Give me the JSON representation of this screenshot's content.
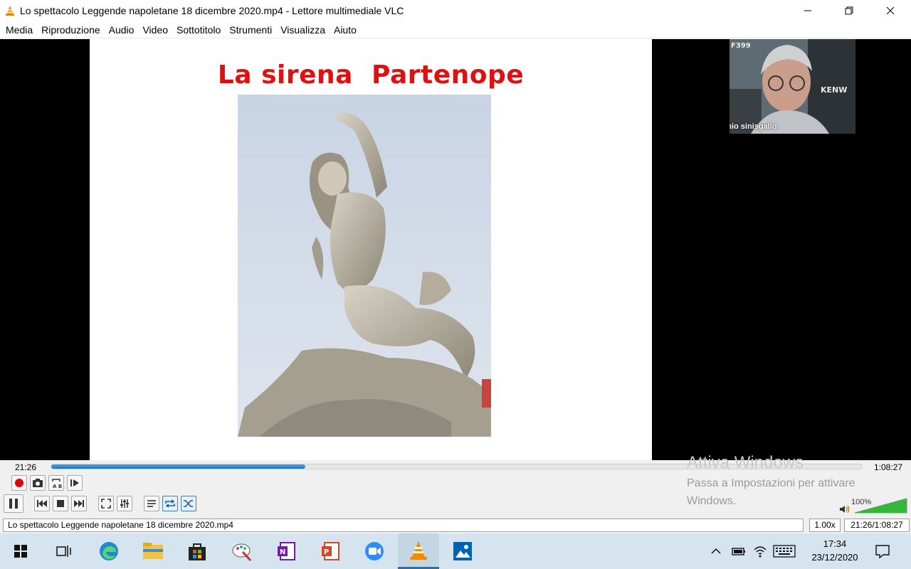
{
  "window": {
    "title": "Lo spettacolo Leggende napoletane 18 dicembre 2020.mp4 - Lettore multimediale VLC",
    "app_icon": "vlc-cone-icon"
  },
  "menu": [
    "Media",
    "Riproduzione",
    "Audio",
    "Video",
    "Sottotitolo",
    "Strumenti",
    "Visualizza",
    "Aiuto"
  ],
  "video": {
    "slide_title": "La sirena  Partenope",
    "webcam_name": "antonio sinisgallo",
    "webcam_bg_text_1": "F399",
    "webcam_bg_text_2": "KENW"
  },
  "playback": {
    "elapsed": "21:26",
    "total": "1:08:27",
    "progress": 0.313
  },
  "volume": {
    "label": "100%",
    "level": 1.0
  },
  "activation": {
    "title": "Attiva Windows",
    "line1": "Passa a Impostazioni per attivare",
    "line2": "Windows."
  },
  "status": {
    "filename": "Lo spettacolo Leggende napoletane 18 dicembre 2020.mp4",
    "speed": "1.00x",
    "time": "21:26/1:08:27"
  },
  "taskbar": {
    "time": "17:34",
    "date": "23/12/2020",
    "apps": [
      "task-view-icon",
      "edge-icon",
      "file-explorer-icon",
      "store-icon",
      "paint-icon",
      "onenote-icon",
      "powerpoint-icon",
      "zoom-icon",
      "vlc-icon",
      "photos-icon"
    ]
  },
  "colors": {
    "slide_title": "#e01010",
    "seek_fill": "#1e74c6",
    "taskbar": "#d5e4ef"
  }
}
